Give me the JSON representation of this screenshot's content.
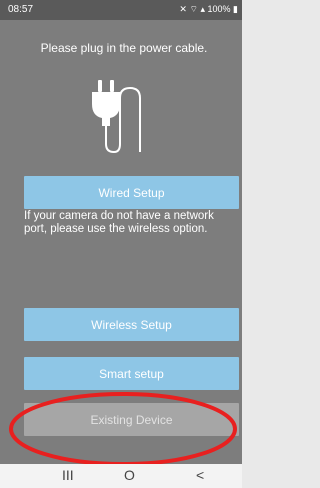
{
  "status_bar": {
    "time": "08:57",
    "indicators": "\u0004ꞥ ≈ .ıl 100%",
    "icons": [
      "mute-icon",
      "wifi-icon",
      "signal-icon",
      "battery-icon"
    ]
  },
  "screen": {
    "instruction": "Please plug in the power cable.",
    "illustration": "power-plug-icon",
    "wired_setup_label": "Wired Setup",
    "note": "If your camera do not have a network port, please use the wireless option.",
    "wireless_setup_label": "Wireless Setup",
    "smart_setup_label": "Smart setup",
    "existing_device_label": "Existing Device"
  },
  "nav_bar": {
    "recents": "III",
    "home": "O",
    "back": "<"
  },
  "colors": {
    "background": "#7d7d7d",
    "button_blue": "#8ec6e6",
    "button_grey": "#a6a6a6",
    "highlight": "#e8201f"
  }
}
